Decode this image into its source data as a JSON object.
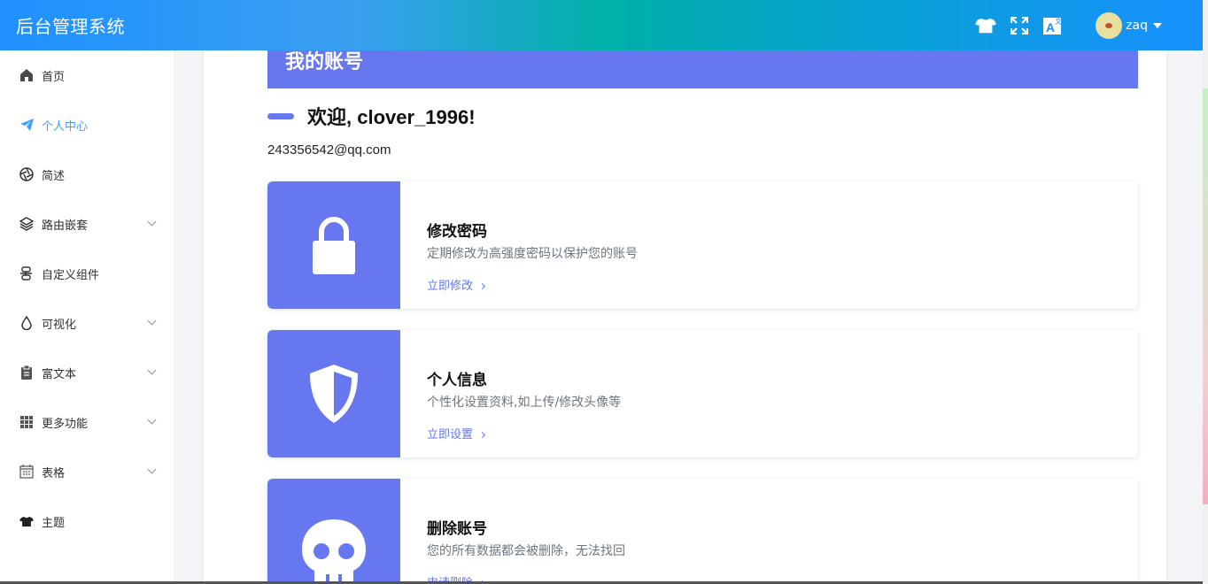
{
  "header": {
    "app_title": "后台管理系统",
    "icons": [
      "tshirt-icon",
      "fullscreen-icon",
      "translate-icon"
    ],
    "username": "zaq"
  },
  "sidebar": {
    "items": [
      {
        "label": "首页",
        "icon": "home-icon"
      },
      {
        "label": "个人中心",
        "icon": "paper-plane-icon",
        "active": true
      },
      {
        "label": "简述",
        "icon": "aperture-icon"
      },
      {
        "label": "路由嵌套",
        "icon": "layers-icon",
        "expandable": true
      },
      {
        "label": "自定义组件",
        "icon": "component-icon"
      },
      {
        "label": "可视化",
        "icon": "drop-icon",
        "expandable": true
      },
      {
        "label": "富文本",
        "icon": "clipboard-icon",
        "expandable": true
      },
      {
        "label": "更多功能",
        "icon": "grid-icon",
        "expandable": true
      },
      {
        "label": "表格",
        "icon": "calendar-icon",
        "expandable": true
      },
      {
        "label": "主题",
        "icon": "tshirt-icon"
      }
    ]
  },
  "main": {
    "banner_title": "我的账号",
    "welcome": "欢迎, clover_1996!",
    "email": "243356542@qq.com",
    "actions": [
      {
        "title": "修改密码",
        "desc": "定期修改为高强度密码以保护您的账号",
        "link": "立即修改",
        "icon": "lock-icon"
      },
      {
        "title": "个人信息",
        "desc": "个性化设置资料,如上传/修改头像等",
        "link": "立即设置",
        "icon": "shield-icon"
      },
      {
        "title": "删除账号",
        "desc": "您的所有数据都会被删除，无法找回",
        "link": "申请删除",
        "icon": "skull-icon"
      }
    ]
  },
  "colors": {
    "accent": "#6777ef",
    "active_menu": "#409eff",
    "header_gradient": [
      "#1e90ff",
      "#00b0a8",
      "#1890ff"
    ]
  }
}
